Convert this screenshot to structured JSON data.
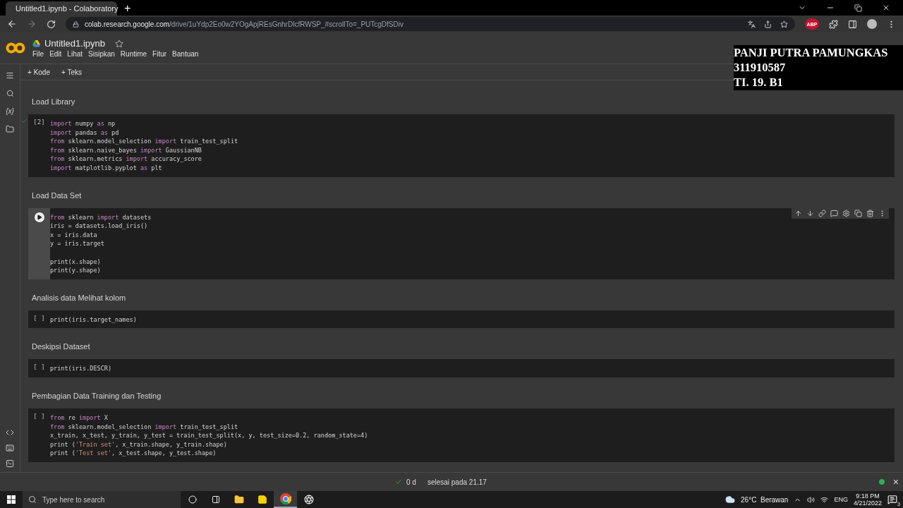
{
  "browser": {
    "tab_title": "Untitled1.ipynb - Colaboratory",
    "new_tab": "+",
    "url_host": "colab.research.google.com",
    "url_path": "/drive/1uYdp2Eo0w2YOgApjREsGnhrDlcfRWSP_#scrollTo=_PUTcgDfSDiv",
    "extension_badge": "ABP"
  },
  "notebook": {
    "title": "Untitled1.ipynb",
    "starred": false,
    "menu": [
      "File",
      "Edit",
      "Lihat",
      "Sisipkan",
      "Runtime",
      "Fitur",
      "Bantuan"
    ],
    "toolbar": [
      {
        "icon": "+",
        "label": "Kode"
      },
      {
        "icon": "+",
        "label": "Teks"
      }
    ],
    "sidebar_label": "{x}",
    "cells": [
      {
        "kind": "text",
        "text": "Load Library"
      },
      {
        "kind": "code",
        "prompt": "[2]",
        "succeeded": true,
        "focused": false,
        "lines": [
          [
            {
              "kind": "keyword",
              "text": "import"
            },
            {
              "kind": "plain",
              "text": " numpy "
            },
            {
              "kind": "keyword",
              "text": "as"
            },
            {
              "kind": "plain",
              "text": " np"
            }
          ],
          [
            {
              "kind": "keyword",
              "text": "import"
            },
            {
              "kind": "plain",
              "text": " pandas "
            },
            {
              "kind": "keyword",
              "text": "as"
            },
            {
              "kind": "plain",
              "text": " pd"
            }
          ],
          [
            {
              "kind": "keyword",
              "text": "from"
            },
            {
              "kind": "plain",
              "text": " sklearn.model_selection "
            },
            {
              "kind": "keyword",
              "text": "import"
            },
            {
              "kind": "plain",
              "text": " train_test_split"
            }
          ],
          [
            {
              "kind": "keyword",
              "text": "from"
            },
            {
              "kind": "plain",
              "text": " sklearn.naive_bayes "
            },
            {
              "kind": "keyword",
              "text": "import"
            },
            {
              "kind": "plain",
              "text": " GaussianNB"
            }
          ],
          [
            {
              "kind": "keyword",
              "text": "from"
            },
            {
              "kind": "plain",
              "text": " sklearn.metrics "
            },
            {
              "kind": "keyword",
              "text": "import"
            },
            {
              "kind": "plain",
              "text": " accuracy_score"
            }
          ],
          [
            {
              "kind": "keyword",
              "text": "import"
            },
            {
              "kind": "plain",
              "text": " matplotlib.pyplot "
            },
            {
              "kind": "keyword",
              "text": "as"
            },
            {
              "kind": "plain",
              "text": " plt"
            }
          ]
        ]
      },
      {
        "kind": "text",
        "text": "Load Data Set"
      },
      {
        "kind": "code",
        "succeeded": false,
        "focused": true,
        "lines": [
          [
            {
              "kind": "keyword",
              "text": "from"
            },
            {
              "kind": "plain",
              "text": " sklearn "
            },
            {
              "kind": "keyword",
              "text": "import"
            },
            {
              "kind": "plain",
              "text": " datasets"
            }
          ],
          [
            {
              "kind": "plain",
              "text": "iris = datasets.load_iris()"
            }
          ],
          [
            {
              "kind": "plain",
              "text": "x = iris.data"
            }
          ],
          [
            {
              "kind": "plain",
              "text": "y = iris.target"
            }
          ],
          [
            {
              "kind": "blank"
            }
          ],
          [
            {
              "kind": "plain",
              "text": "print(x.shape)"
            }
          ],
          [
            {
              "kind": "plain",
              "text": "print(y.shape)"
            }
          ]
        ]
      },
      {
        "kind": "text",
        "text": "Analisis data Melihat kolom"
      },
      {
        "kind": "code",
        "prompt": "[ ]",
        "succeeded": false,
        "focused": false,
        "lines": [
          [
            {
              "kind": "plain",
              "text": "print(iris.target_names)"
            }
          ]
        ]
      },
      {
        "kind": "text",
        "text": "Deskipsi Dataset"
      },
      {
        "kind": "code",
        "prompt": "[ ]",
        "succeeded": false,
        "focused": false,
        "lines": [
          [
            {
              "kind": "plain",
              "text": "print(iris.DESCR)"
            }
          ]
        ]
      },
      {
        "kind": "text",
        "text": "Pembagian Data Training dan Testing"
      },
      {
        "kind": "code",
        "prompt": "[ ]",
        "succeeded": false,
        "focused": false,
        "lines": [
          [
            {
              "kind": "keyword",
              "text": "from"
            },
            {
              "kind": "plain",
              "text": " re "
            },
            {
              "kind": "keyword",
              "text": "import"
            },
            {
              "kind": "plain",
              "text": " X"
            }
          ],
          [
            {
              "kind": "keyword",
              "text": "from"
            },
            {
              "kind": "plain",
              "text": " sklearn.model_selection "
            },
            {
              "kind": "keyword",
              "text": "import"
            },
            {
              "kind": "plain",
              "text": " train_test_split"
            }
          ],
          [
            {
              "kind": "plain",
              "text": "x_train, x_test, y_train, y_test = train_test_split(x, y, test_size=0.2, random_state=4)"
            }
          ],
          [
            {
              "kind": "plain",
              "text": "print ("
            },
            {
              "kind": "string",
              "text": "'Train set'"
            },
            {
              "kind": "plain",
              "text": ", x_train.shape, y_train.shape)"
            }
          ],
          [
            {
              "kind": "plain",
              "text": "print ("
            },
            {
              "kind": "string",
              "text": "'Test set'"
            },
            {
              "kind": "plain",
              "text": ", x_test.shape, y_test.shape)"
            }
          ]
        ]
      }
    ]
  },
  "overlay_caption": [
    "PANJI PUTRA PAMUNGKAS",
    "311910587",
    "TI. 19. B1"
  ],
  "status_bar": {
    "duration": "0 d",
    "message": "selesai pada 21.17",
    "connected": true,
    "close": "×"
  },
  "taskbar": {
    "search_placeholder": "Type here to search",
    "weather": "26°C  Berawan",
    "language": "ENG",
    "time": "9:18 PM",
    "date": "4/21/2022",
    "notifications": "3"
  }
}
